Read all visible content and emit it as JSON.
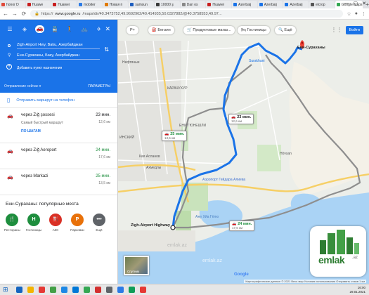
{
  "browser": {
    "tabs": [
      {
        "label": "honor D",
        "color": "#e04a3a"
      },
      {
        "label": "Huawe",
        "color": "#c81e1e"
      },
      {
        "label": "Huawei",
        "color": "#c81e1e"
      },
      {
        "label": "mobiter",
        "color": "#2d7be5"
      },
      {
        "label": "Новая п",
        "color": "#e07a00"
      },
      {
        "label": "samsun",
        "color": "#1f5fbf"
      },
      {
        "label": "10000 ş",
        "color": "#3a3a3a"
      },
      {
        "label": "Dan os",
        "color": "#888888"
      },
      {
        "label": "Huawei",
        "color": "#c81e1e"
      },
      {
        "label": "Azerbaij",
        "color": "#1a73e8"
      },
      {
        "label": "Azerbaij",
        "color": "#1a73e8"
      },
      {
        "label": "Azerbaij",
        "color": "#1a73e8"
      },
      {
        "label": "elcrop",
        "color": "#555555"
      }
    ],
    "active_tab": "Google Maps",
    "new_tab_icon": "+",
    "url_prefix": "https://",
    "url_host": "www.google.ru",
    "url_rest": "/maps/dir/40.3473752,49.9692962/40.414935,50.0327882/@40.3758553,49.97..."
  },
  "panel": {
    "modes": [
      "route-icon",
      "car-icon",
      "transit-icon",
      "walk-icon",
      "bike-icon",
      "plane-icon"
    ],
    "origin": "Zigh-Airport Hwy, Baku, Азербайджан",
    "destination": "Ени-Сураханы, Баку, Азербайджан",
    "add_point": "Добавить пункт назначения",
    "depart": "Отправление сейчас",
    "options": "ПАРАМЕТРЫ",
    "send_phone": "Отправить маршрут на телефон",
    "routes": [
      {
        "name": "через Zığ şossesi",
        "time": "23 мин.",
        "distance": "12,6 км",
        "sub": "Самый быстрый маршрут",
        "link": "ПО ШАГАМ",
        "green": false
      },
      {
        "name": "через Zığ Aeroport",
        "time": "24 мин.",
        "distance": "17,6 км",
        "sub": "",
        "link": "",
        "green": true
      },
      {
        "name": "через Markazi",
        "time": "25 мин.",
        "distance": "13,5 км",
        "sub": "",
        "link": "",
        "green": true
      }
    ],
    "popular_title": "Ени-Сураханы: популярные места",
    "categories": [
      {
        "label": "Рестораны",
        "icon": "restaurant-icon",
        "glyph": "🍴",
        "color": "#1e8e3e"
      },
      {
        "label": "Гостиницы",
        "icon": "hotel-icon",
        "glyph": "H",
        "color": "#1e8e3e"
      },
      {
        "label": "АЗС",
        "icon": "gas-icon",
        "glyph": "⛽",
        "color": "#d93025"
      },
      {
        "label": "Парковки",
        "icon": "parking-icon",
        "glyph": "P",
        "color": "#e8710a"
      },
      {
        "label": "Ещё",
        "icon": "more-icon",
        "glyph": "•••",
        "color": "#5f6368"
      }
    ]
  },
  "map": {
    "toolbar": [
      {
        "label": "Р+"
      },
      {
        "label": "⛽ Бензин"
      },
      {
        "label": "🛒 Продуктовые магаз..."
      },
      {
        "label": "🛏 Гостиницы"
      },
      {
        "label": "🔍 Ещё"
      }
    ],
    "signin": "Войти",
    "callouts": [
      {
        "time": "23 мин.",
        "distance": "12,6 км",
        "green": false
      },
      {
        "time": "25 мин.",
        "distance": "13,5 км",
        "green": true
      },
      {
        "time": "24 мин.",
        "distance": "17,6 км",
        "green": true
      }
    ],
    "labels": {
      "destination": "Ени-Сураханы",
      "origin": "Zigh-Airport Highway",
      "karachukhur": "КАРАЧУХУР",
      "surakhani": "Surakhani",
      "yeni_gunashli": "ЕНИ ГЮНЕШЛИ",
      "hovsan": "Hövsan",
      "airport": "Аэропорт Гейдара Алиева",
      "lake": "Ажу Хйа Гёлю",
      "nafta": "Нефтяные",
      "khatai": "ИНСКИЙ",
      "ahmadli": "Ахмедлы",
      "dzhafer": "Кая Асланов"
    },
    "satellite": "Спутник",
    "copyright": "Картографические данные © 2021   Весь мир   Условия использования   Отправить отзыв   1 км",
    "google": "Google",
    "watermark": "emlak.az",
    "logo_text": "emlak",
    "logo_suffix": ".az"
  },
  "taskbar": {
    "time": "16:00",
    "date": "29.01.2021",
    "apps": [
      "#1565c0",
      "#f4b400",
      "#e53935",
      "#43a047",
      "#1e88e5",
      "#0078d7",
      "#34a853",
      "#d32f2f",
      "#5f6368",
      "#2d7be5",
      "#0f9d58",
      "#e53935"
    ]
  }
}
